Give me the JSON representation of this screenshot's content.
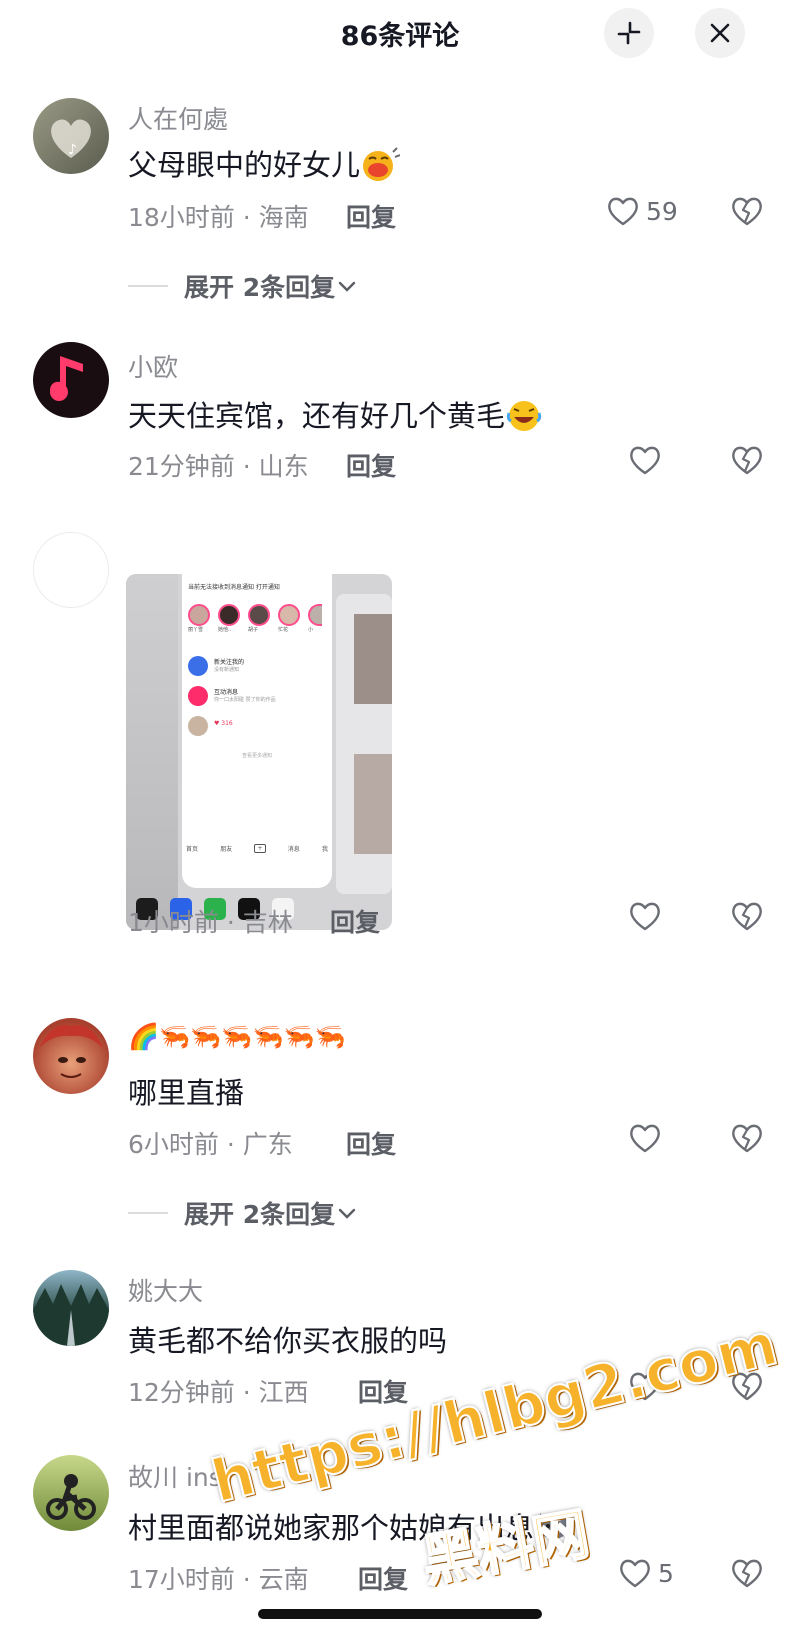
{
  "header": {
    "title": "86条评论"
  },
  "comments": [
    {
      "username": "人在何處",
      "text": "父母眼中的好女儿",
      "time": "18小时前",
      "location": "海南",
      "reply_label": "回复",
      "likes": "59",
      "expand_label": "展开 2条回复"
    },
    {
      "username": "小欧",
      "text": "天天住宾馆，还有好几个黄毛",
      "time": "21分钟前",
      "location": "山东",
      "reply_label": "回复",
      "likes": ""
    },
    {
      "username": "",
      "text": "",
      "time": "1小时前",
      "location": "吉林",
      "reply_label": "回复",
      "likes": ""
    },
    {
      "username": "🌈🦐🦐🦐🦐🦐🦐",
      "text": "哪里直播",
      "time": "6小时前",
      "location": "广东",
      "reply_label": "回复",
      "likes": "",
      "expand_label": "展开 2条回复"
    },
    {
      "username": "姚大大",
      "text": "黄毛都不给你买衣服的吗",
      "time": "12分钟前",
      "location": "江西",
      "reply_label": "回复",
      "likes": ""
    },
    {
      "username": "故川 ins",
      "text": "村里面都说她家那个姑娘有出息",
      "time": "17小时前",
      "location": "云南",
      "reply_label": "回复",
      "likes": "5"
    }
  ],
  "embedded_screenshot": {
    "banner": "当前无法接收到消息通知 打开通知",
    "stories": [
      "丽丫雪",
      "她他..",
      "胡子",
      "忙花",
      "小"
    ],
    "rows": [
      {
        "title": "新关注我的",
        "sub": "没有新通知"
      },
      {
        "title": "互动消息",
        "sub": "你一口太阳碰 赞了你的作品"
      },
      {
        "title": "♥ 316",
        "sub": ""
      }
    ],
    "more": "查看更多通知",
    "tabs": [
      "首页",
      "朋友",
      "+",
      "消息",
      "我"
    ]
  },
  "watermark": {
    "url": "https://hlbg2.com",
    "name": "黑料网"
  }
}
